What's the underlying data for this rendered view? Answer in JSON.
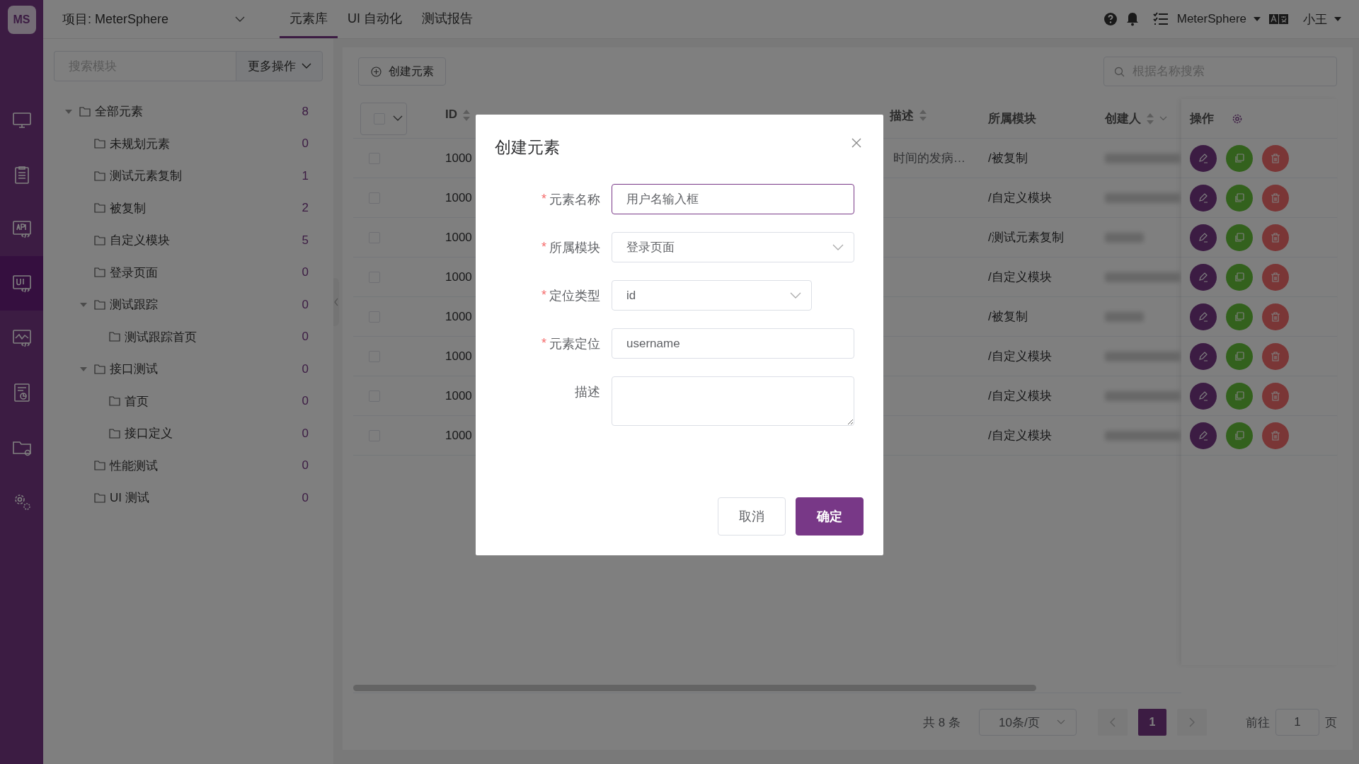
{
  "logo": {
    "text": "MS"
  },
  "sidebar": {
    "items": [
      {
        "kind": "monitor",
        "selected": false
      },
      {
        "kind": "clipboard",
        "selected": false
      },
      {
        "kind": "api",
        "selected": false
      },
      {
        "kind": "ui",
        "selected": true
      },
      {
        "kind": "chart",
        "selected": false
      },
      {
        "kind": "report",
        "selected": false
      },
      {
        "kind": "folder-gear",
        "selected": false
      },
      {
        "kind": "gears",
        "selected": false
      }
    ]
  },
  "header": {
    "project": "项目: MeterSphere",
    "tabs": [
      {
        "label": "元素库",
        "selected": true
      },
      {
        "label": "UI 自动化",
        "selected": false
      },
      {
        "label": "测试报告",
        "selected": false
      }
    ],
    "workspace": "MeterSphere",
    "user": "小王"
  },
  "module_panel": {
    "search": {
      "placeholder": "搜索模块"
    },
    "more_button": "更多操作",
    "tree": [
      {
        "label": "全部元素",
        "count": "8",
        "expanded": true,
        "children": [
          {
            "label": "未规划元素",
            "count": "0"
          },
          {
            "label": "测试元素复制",
            "count": "1"
          },
          {
            "label": "被复制",
            "count": "2"
          },
          {
            "label": "自定义模块",
            "count": "5"
          },
          {
            "label": "登录页面",
            "count": "0"
          },
          {
            "label": "测试跟踪",
            "count": "0",
            "expanded": true,
            "children": [
              {
                "label": "测试跟踪首页",
                "count": "0"
              }
            ]
          },
          {
            "label": "接口测试",
            "count": "0",
            "expanded": true,
            "children": [
              {
                "label": "首页",
                "count": "0"
              },
              {
                "label": "接口定义",
                "count": "0"
              }
            ]
          },
          {
            "label": "性能测试",
            "count": "0"
          },
          {
            "label": "UI 测试",
            "count": "0"
          }
        ]
      }
    ]
  },
  "toolbar": {
    "create_button": "创建元素",
    "search": {
      "placeholder": "根据名称搜索"
    }
  },
  "table": {
    "select_all": {
      "checked": false
    },
    "columns": [
      {
        "kind": "id",
        "label": "ID",
        "sortable": true,
        "filterable": false
      },
      {
        "kind": "description",
        "label": "描述",
        "sortable": true,
        "filterable": false
      },
      {
        "kind": "module",
        "label": "所属模块",
        "sortable": false,
        "filterable": false
      },
      {
        "kind": "creator",
        "label": "创建人",
        "sortable": true,
        "filterable": true
      },
      {
        "kind": "actions",
        "label": "操作",
        "sortable": false,
        "filterable": false
      }
    ],
    "rows": [
      {
        "id": "1000",
        "description": "时间的发病…",
        "module": "/被复制",
        "creator_short": false,
        "selected": false
      },
      {
        "id": "1000",
        "module": "/自定义模块",
        "creator_short": false,
        "selected": false
      },
      {
        "id": "1000",
        "module": "/测试元素复制",
        "creator_short": true,
        "selected": false
      },
      {
        "id": "1000",
        "module": "/自定义模块",
        "creator_short": false,
        "selected": false
      },
      {
        "id": "1000",
        "module": "/被复制",
        "creator_short": true,
        "selected": false
      },
      {
        "id": "1000",
        "module": "/自定义模块",
        "creator_short": false,
        "selected": false
      },
      {
        "id": "1000",
        "module": "/自定义模块",
        "creator_short": false,
        "selected": false
      },
      {
        "id": "1000",
        "module": "/自定义模块",
        "creator_short": false,
        "selected": false
      }
    ]
  },
  "pagination": {
    "total": "共 8 条",
    "page_size": "10条/页",
    "pages": [
      {
        "label": "1",
        "selected": true
      }
    ],
    "goto_label": "前往",
    "goto_value": "1",
    "page_suffix": "页"
  },
  "dialog": {
    "title": "创建元素",
    "required_mark": "*",
    "fields": [
      {
        "label": "元素名称",
        "required": true,
        "kind": "input",
        "value": "用户名输入框",
        "focused": true
      },
      {
        "label": "所属模块",
        "required": true,
        "kind": "select",
        "value": "登录页面",
        "focused": false
      },
      {
        "label": "定位类型",
        "required": true,
        "kind": "select-short",
        "value": "id",
        "focused": false
      },
      {
        "label": "元素定位",
        "required": true,
        "kind": "input",
        "value": "username",
        "focused": false
      },
      {
        "label": "描述",
        "required": false,
        "kind": "textarea",
        "focused": false
      }
    ],
    "buttons": [
      {
        "label": "取消",
        "kind": "secondary"
      },
      {
        "label": "确定",
        "kind": "primary"
      }
    ]
  }
}
